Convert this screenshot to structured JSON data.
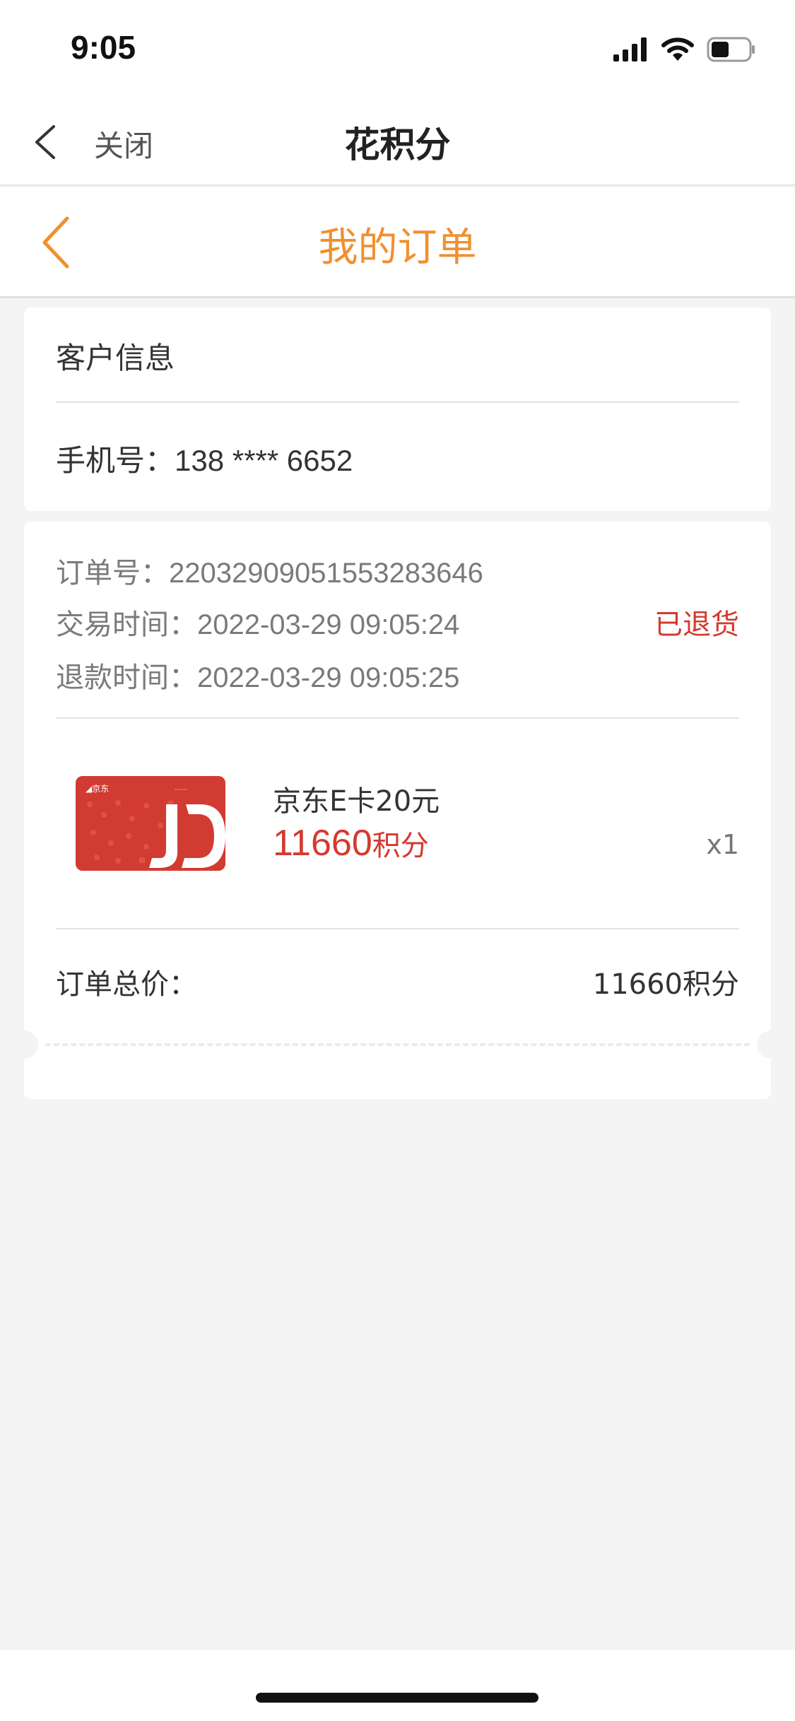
{
  "status_bar": {
    "time": "9:05",
    "icons": [
      "signal-icon",
      "wifi-icon",
      "battery-icon"
    ]
  },
  "top_nav": {
    "back_icon": "chevron-left-icon",
    "close_label": "关闭",
    "title": "花积分"
  },
  "sub_nav": {
    "back_icon": "chevron-left-icon",
    "title": "我的订单",
    "accent_color": "#f0902f"
  },
  "customer": {
    "title": "客户信息",
    "phone_label": "手机号：",
    "phone_value": "138 **** 6652"
  },
  "order": {
    "number_label": "订单号：",
    "number_value": "2203290905155328364​6",
    "trade_time_label": "交易时间：",
    "trade_time_value": "2022-03-29 09:05:24",
    "refund_time_label": "退款时间：",
    "refund_time_value": "2022-03-29 09:05:25",
    "status": "已退货",
    "status_color": "#d4392f",
    "product": {
      "image_icon": "jd-ecard-image",
      "name": "京东E卡20元",
      "price_number": "11660",
      "price_unit": "积分",
      "quantity": "x1"
    },
    "total_label": "订单总价：",
    "total_value": "11660积分"
  }
}
